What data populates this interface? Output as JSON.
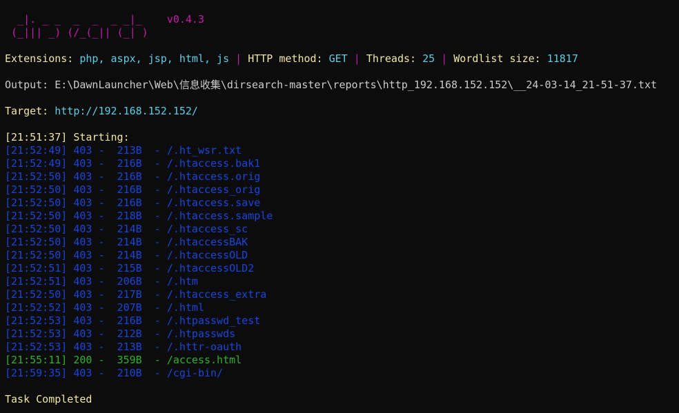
{
  "banner": {
    "line1": "  _|. _ _  _  _  _ _|_    ",
    "line2": " (_||| _) (/_(_|| (_| )",
    "version": "v0.4.3"
  },
  "config": {
    "extensions_label": "Extensions:",
    "extensions_value": "php, aspx, jsp, html, js",
    "sep": "|",
    "method_label": "HTTP method:",
    "method_value": "GET",
    "threads_label": "Threads:",
    "threads_value": "25",
    "wordlist_label": "Wordlist size:",
    "wordlist_value": "11817"
  },
  "output": {
    "label": "Output:",
    "path": "E:\\DawnLauncher\\Web\\信息收集\\dirsearch-master\\reports\\http_192.168.152.152\\__24-03-14_21-51-37.txt"
  },
  "target": {
    "label": "Target:",
    "url": "http://192.168.152.152/"
  },
  "start": {
    "time": "[21:51:37]",
    "label": "Starting:"
  },
  "results": [
    {
      "time": "[21:52:49]",
      "status": "403",
      "size": "213B",
      "path": "/.ht_wsr.txt",
      "color": "blue"
    },
    {
      "time": "[21:52:49]",
      "status": "403",
      "size": "216B",
      "path": "/.htaccess.bak1",
      "color": "blue"
    },
    {
      "time": "[21:52:50]",
      "status": "403",
      "size": "216B",
      "path": "/.htaccess.orig",
      "color": "blue"
    },
    {
      "time": "[21:52:50]",
      "status": "403",
      "size": "216B",
      "path": "/.htaccess_orig",
      "color": "blue"
    },
    {
      "time": "[21:52:50]",
      "status": "403",
      "size": "216B",
      "path": "/.htaccess.save",
      "color": "blue"
    },
    {
      "time": "[21:52:50]",
      "status": "403",
      "size": "218B",
      "path": "/.htaccess.sample",
      "color": "blue"
    },
    {
      "time": "[21:52:50]",
      "status": "403",
      "size": "214B",
      "path": "/.htaccess_sc",
      "color": "blue"
    },
    {
      "time": "[21:52:50]",
      "status": "403",
      "size": "214B",
      "path": "/.htaccessBAK",
      "color": "blue"
    },
    {
      "time": "[21:52:50]",
      "status": "403",
      "size": "214B",
      "path": "/.htaccessOLD",
      "color": "blue"
    },
    {
      "time": "[21:52:51]",
      "status": "403",
      "size": "215B",
      "path": "/.htaccessOLD2",
      "color": "blue"
    },
    {
      "time": "[21:52:51]",
      "status": "403",
      "size": "206B",
      "path": "/.htm",
      "color": "blue"
    },
    {
      "time": "[21:52:50]",
      "status": "403",
      "size": "217B",
      "path": "/.htaccess_extra",
      "color": "blue"
    },
    {
      "time": "[21:52:52]",
      "status": "403",
      "size": "207B",
      "path": "/.html",
      "color": "blue"
    },
    {
      "time": "[21:52:53]",
      "status": "403",
      "size": "216B",
      "path": "/.htpasswd_test",
      "color": "blue"
    },
    {
      "time": "[21:52:53]",
      "status": "403",
      "size": "212B",
      "path": "/.htpasswds",
      "color": "blue"
    },
    {
      "time": "[21:52:53]",
      "status": "403",
      "size": "213B",
      "path": "/.httr-oauth",
      "color": "blue"
    },
    {
      "time": "[21:55:11]",
      "status": "200",
      "size": "359B",
      "path": "/access.html",
      "color": "green"
    },
    {
      "time": "[21:59:35]",
      "status": "403",
      "size": "210B",
      "path": "/cgi-bin/",
      "color": "blue"
    }
  ],
  "dash": "-",
  "footer": "Task Completed",
  "colors": {
    "background": "#0c0c0c",
    "blue": "#1b45d8",
    "green": "#2fb12f",
    "yellow": "#f0e7a3",
    "cyan": "#5ccfe6",
    "magenta": "#c81cad"
  }
}
